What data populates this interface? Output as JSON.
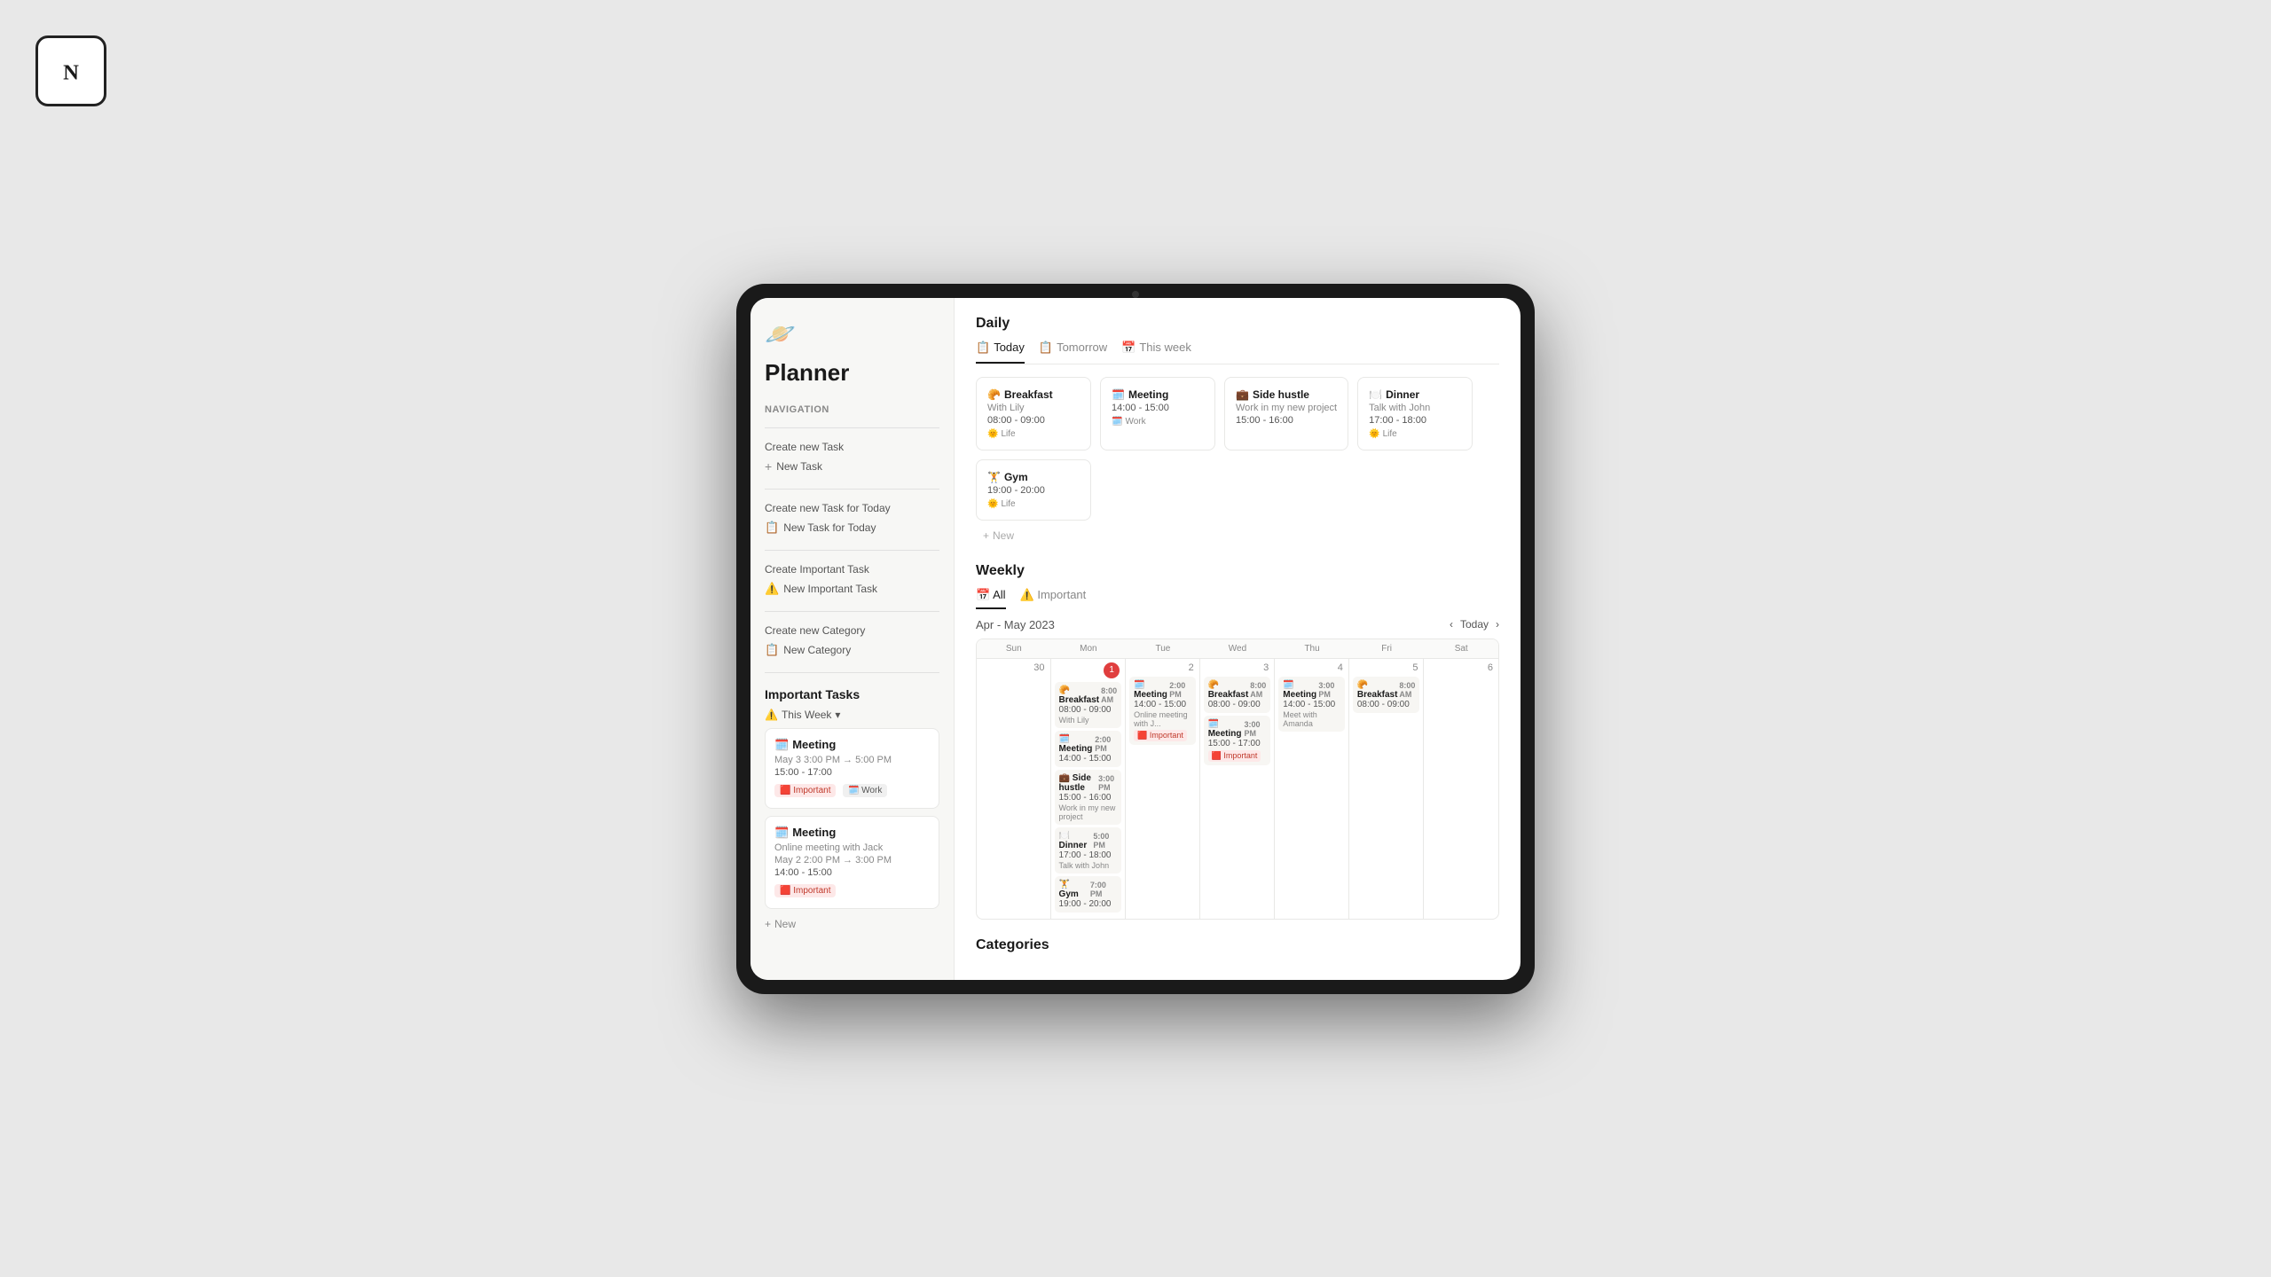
{
  "notionLogo": "N",
  "appIcon": "🪐",
  "pageTitle": "Planner",
  "sidebar": {
    "navigationLabel": "Navigation",
    "createTask": {
      "label": "Create new Task",
      "btnLabel": "New Task"
    },
    "createTaskToday": {
      "label": "Create new Task for Today",
      "btnLabel": "New Task for Today"
    },
    "createImportantTask": {
      "label": "Create Important Task",
      "btnLabel": "New Important Task"
    },
    "createCategory": {
      "label": "Create new Category",
      "btnLabel": "New Category"
    },
    "importantTasks": {
      "title": "Important Tasks",
      "thisWeek": "This Week",
      "tasks": [
        {
          "icon": "🗓️",
          "title": "Meeting",
          "date": "May 3 3:00 PM → 5:00 PM",
          "time": "15:00 - 17:00",
          "tags": [
            "Important",
            "Work"
          ]
        },
        {
          "icon": "🗓️",
          "title": "Meeting",
          "date": "May 2 2:00 PM → 3:00 PM",
          "sub": "Online meeting with Jack",
          "time": "14:00 - 15:00",
          "tags": [
            "Important"
          ]
        }
      ],
      "newBtnLabel": "New"
    }
  },
  "daily": {
    "sectionTitle": "Daily",
    "tabs": [
      {
        "label": "Today",
        "icon": "📋",
        "active": true
      },
      {
        "label": "Tomorrow",
        "icon": "📋",
        "active": false
      },
      {
        "label": "This week",
        "icon": "📅",
        "active": false
      }
    ],
    "cards": [
      {
        "emoji": "🥐",
        "title": "Breakfast",
        "sub": "With Lily",
        "time": "08:00 - 09:00",
        "tag": "Life",
        "tagIcon": "🌞"
      },
      {
        "emoji": "🗓️",
        "title": "Meeting",
        "sub": "",
        "time": "14:00 - 15:00",
        "tag": "Work",
        "tagIcon": "🗓️"
      },
      {
        "emoji": "💼",
        "title": "Side hustle",
        "sub": "Work in my new project",
        "time": "15:00 - 16:00",
        "tag": "",
        "tagIcon": ""
      },
      {
        "emoji": "🍽️",
        "title": "Dinner",
        "sub": "Talk with John",
        "time": "17:00 - 18:00",
        "tag": "Life",
        "tagIcon": "🌞"
      },
      {
        "emoji": "🏋️",
        "title": "Gym",
        "sub": "",
        "time": "19:00 - 20:00",
        "tag": "Life",
        "tagIcon": "🌞"
      }
    ],
    "newBtnLabel": "New"
  },
  "weekly": {
    "sectionTitle": "Weekly",
    "tabs": [
      {
        "label": "All",
        "icon": "📅",
        "active": true
      },
      {
        "label": "Important",
        "icon": "⚠️",
        "active": false
      }
    ],
    "dateRange": "Apr - May 2023",
    "todayBtn": "Today",
    "dayHeaders": [
      "Sun",
      "Mon",
      "Tue",
      "Wed",
      "Thu",
      "Fri",
      "Sat"
    ],
    "days": [
      {
        "number": "30",
        "isToday": false,
        "events": []
      },
      {
        "number": "1",
        "isToday": true,
        "events": [
          {
            "emoji": "🥐",
            "title": "Breakfast",
            "time": "08:00 - 09:00",
            "timeLabel": "8:00 AM",
            "sub": "With Lily"
          },
          {
            "emoji": "🗓️",
            "title": "Meeting",
            "time": "14:00 - 15:00",
            "timeLabel": "2:00 PM",
            "sub": ""
          },
          {
            "emoji": "💼",
            "title": "Side hustle",
            "time": "15:00 - 16:00",
            "timeLabel": "3:00 PM",
            "sub": "Work in my new project"
          },
          {
            "emoji": "🍽️",
            "title": "Dinner",
            "time": "17:00 - 18:00",
            "timeLabel": "5:00 PM",
            "sub": "Talk with John"
          },
          {
            "emoji": "🏋️",
            "title": "Gym",
            "time": "19:00 - 20:00",
            "timeLabel": "7:00 PM",
            "sub": ""
          }
        ]
      },
      {
        "number": "2",
        "isToday": false,
        "events": [
          {
            "emoji": "🗓️",
            "title": "Meeting",
            "time": "14:00 - 15:00",
            "timeLabel": "2:00 PM",
            "sub": "Online meeting with J...",
            "important": true
          }
        ]
      },
      {
        "number": "3",
        "isToday": false,
        "events": [
          {
            "emoji": "🥐",
            "title": "Breakfast",
            "time": "08:00 - 09:00",
            "timeLabel": "8:00 AM",
            "sub": ""
          },
          {
            "emoji": "🗓️",
            "title": "Meeting",
            "time": "15:00 - 17:00",
            "timeLabel": "3:00 PM",
            "sub": "",
            "important": true
          }
        ]
      },
      {
        "number": "4",
        "isToday": false,
        "events": [
          {
            "emoji": "🗓️",
            "title": "Meeting",
            "time": "14:00 - 15:00",
            "timeLabel": "3:00 PM",
            "sub": "Meet with Amanda"
          }
        ]
      },
      {
        "number": "5",
        "isToday": false,
        "events": [
          {
            "emoji": "🥐",
            "title": "Breakfast",
            "time": "08:00 - 09:00",
            "timeLabel": "8:00 AM",
            "sub": ""
          }
        ]
      },
      {
        "number": "6",
        "isToday": false,
        "events": []
      }
    ]
  },
  "categories": {
    "sectionTitle": "Categories"
  }
}
